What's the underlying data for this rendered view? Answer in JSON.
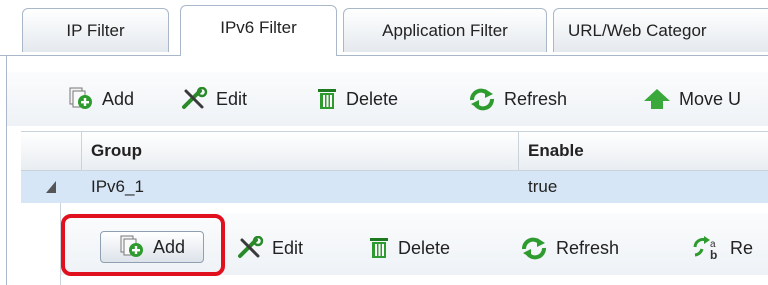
{
  "tabs": [
    {
      "label": "IP Filter"
    },
    {
      "label": "IPv6 Filter",
      "active": true
    },
    {
      "label": "Application Filter"
    },
    {
      "label": "URL/Web Categor"
    }
  ],
  "toolbar": {
    "add": "Add",
    "edit": "Edit",
    "delete": "Delete",
    "refresh": "Refresh",
    "move_up": "Move U"
  },
  "grid": {
    "columns": [
      "Group",
      "Enable"
    ],
    "rows": [
      {
        "group": "IPv6_1",
        "enable": "true",
        "expander_icon": "collapse-triangle-icon"
      }
    ]
  },
  "subtoolbar": {
    "add": "Add",
    "edit": "Edit",
    "delete": "Delete",
    "refresh": "Refresh",
    "rename": "Re"
  },
  "colors": {
    "highlight": "#e0101e",
    "selected_row": "#d7e6f7",
    "border": "#a9b8c8"
  }
}
